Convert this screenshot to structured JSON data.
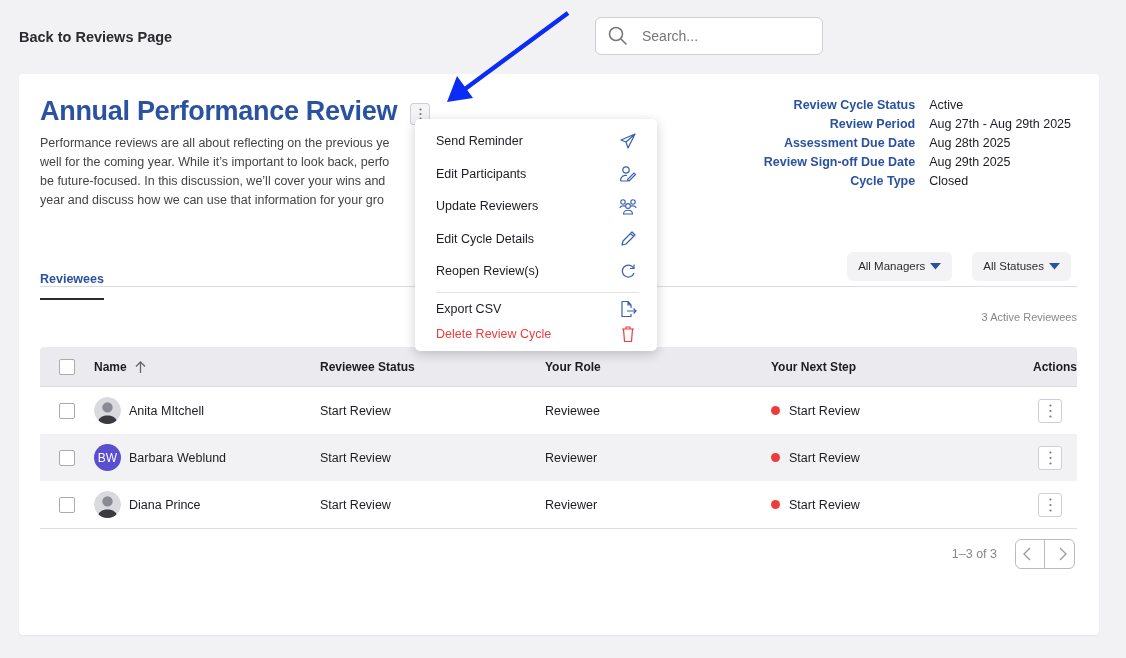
{
  "back_link": "Back to Reviews Page",
  "search": {
    "placeholder": "Search..."
  },
  "review": {
    "title": "Annual Performance Review",
    "description_lines": [
      "Performance reviews are all about reflecting on the previous ye",
      "well for the coming year. While it’s important to look back, perfo",
      "be future-focused. In this discussion, we’ll cover your wins and",
      "year and discuss how we can use that information for your gro"
    ],
    "details": [
      {
        "label": "Review Cycle Status",
        "value": "Active"
      },
      {
        "label": "Review Period",
        "value": "Aug 27th - Aug 29th 2025"
      },
      {
        "label": "Assessment Due Date",
        "value": "Aug 28th 2025"
      },
      {
        "label": "Review Sign-off Due Date",
        "value": "Aug 29th 2025"
      },
      {
        "label": "Cycle Type",
        "value": "Closed"
      }
    ]
  },
  "menu": {
    "open": true,
    "items": [
      {
        "label": "Send Reminder",
        "kind": "send",
        "danger": false,
        "divider_before": false
      },
      {
        "label": "Edit Participants",
        "kind": "person-edit",
        "danger": false,
        "divider_before": false
      },
      {
        "label": "Update Reviewers",
        "kind": "people",
        "danger": false,
        "divider_before": false
      },
      {
        "label": "Edit Cycle Details",
        "kind": "pencil",
        "danger": false,
        "divider_before": false
      },
      {
        "label": "Reopen Review(s)",
        "kind": "refresh",
        "danger": false,
        "divider_before": false
      },
      {
        "label": "Export CSV",
        "kind": "export",
        "danger": false,
        "divider_before": true
      },
      {
        "label": "Delete Review Cycle",
        "kind": "trash",
        "danger": true,
        "divider_before": false
      }
    ]
  },
  "tabs": [
    {
      "label": "Reviewees",
      "selected": true
    }
  ],
  "filters": [
    "All Managers",
    "All Statuses"
  ],
  "count": "3 Active Reviewees",
  "table": {
    "all_checked": false,
    "columns": [
      "Name",
      "Reviewee Status",
      "Your Role",
      "Your Next Step",
      "Actions"
    ],
    "rows": [
      {
        "checked": false,
        "avatar": {
          "kind": "photo"
        },
        "name": "Anita MItchell",
        "status": "Start Review",
        "role": "Reviewee",
        "next_step": "Start Review",
        "color": "#ef3b3b"
      },
      {
        "checked": false,
        "avatar": {
          "kind": "initials",
          "initials": "BW",
          "color": "#5a4fcf"
        },
        "name": "Barbara Weblund",
        "status": "Start Review",
        "role": "Reviewer",
        "next_step": "Start Review",
        "color": "#ef3b3b"
      },
      {
        "checked": false,
        "avatar": {
          "kind": "photo"
        },
        "name": "Diana Prince",
        "status": "Start Review",
        "role": "Reviewer",
        "next_step": "Start Review",
        "color": "#ef3b3b"
      }
    ]
  },
  "pagination": "1–3 of 3"
}
